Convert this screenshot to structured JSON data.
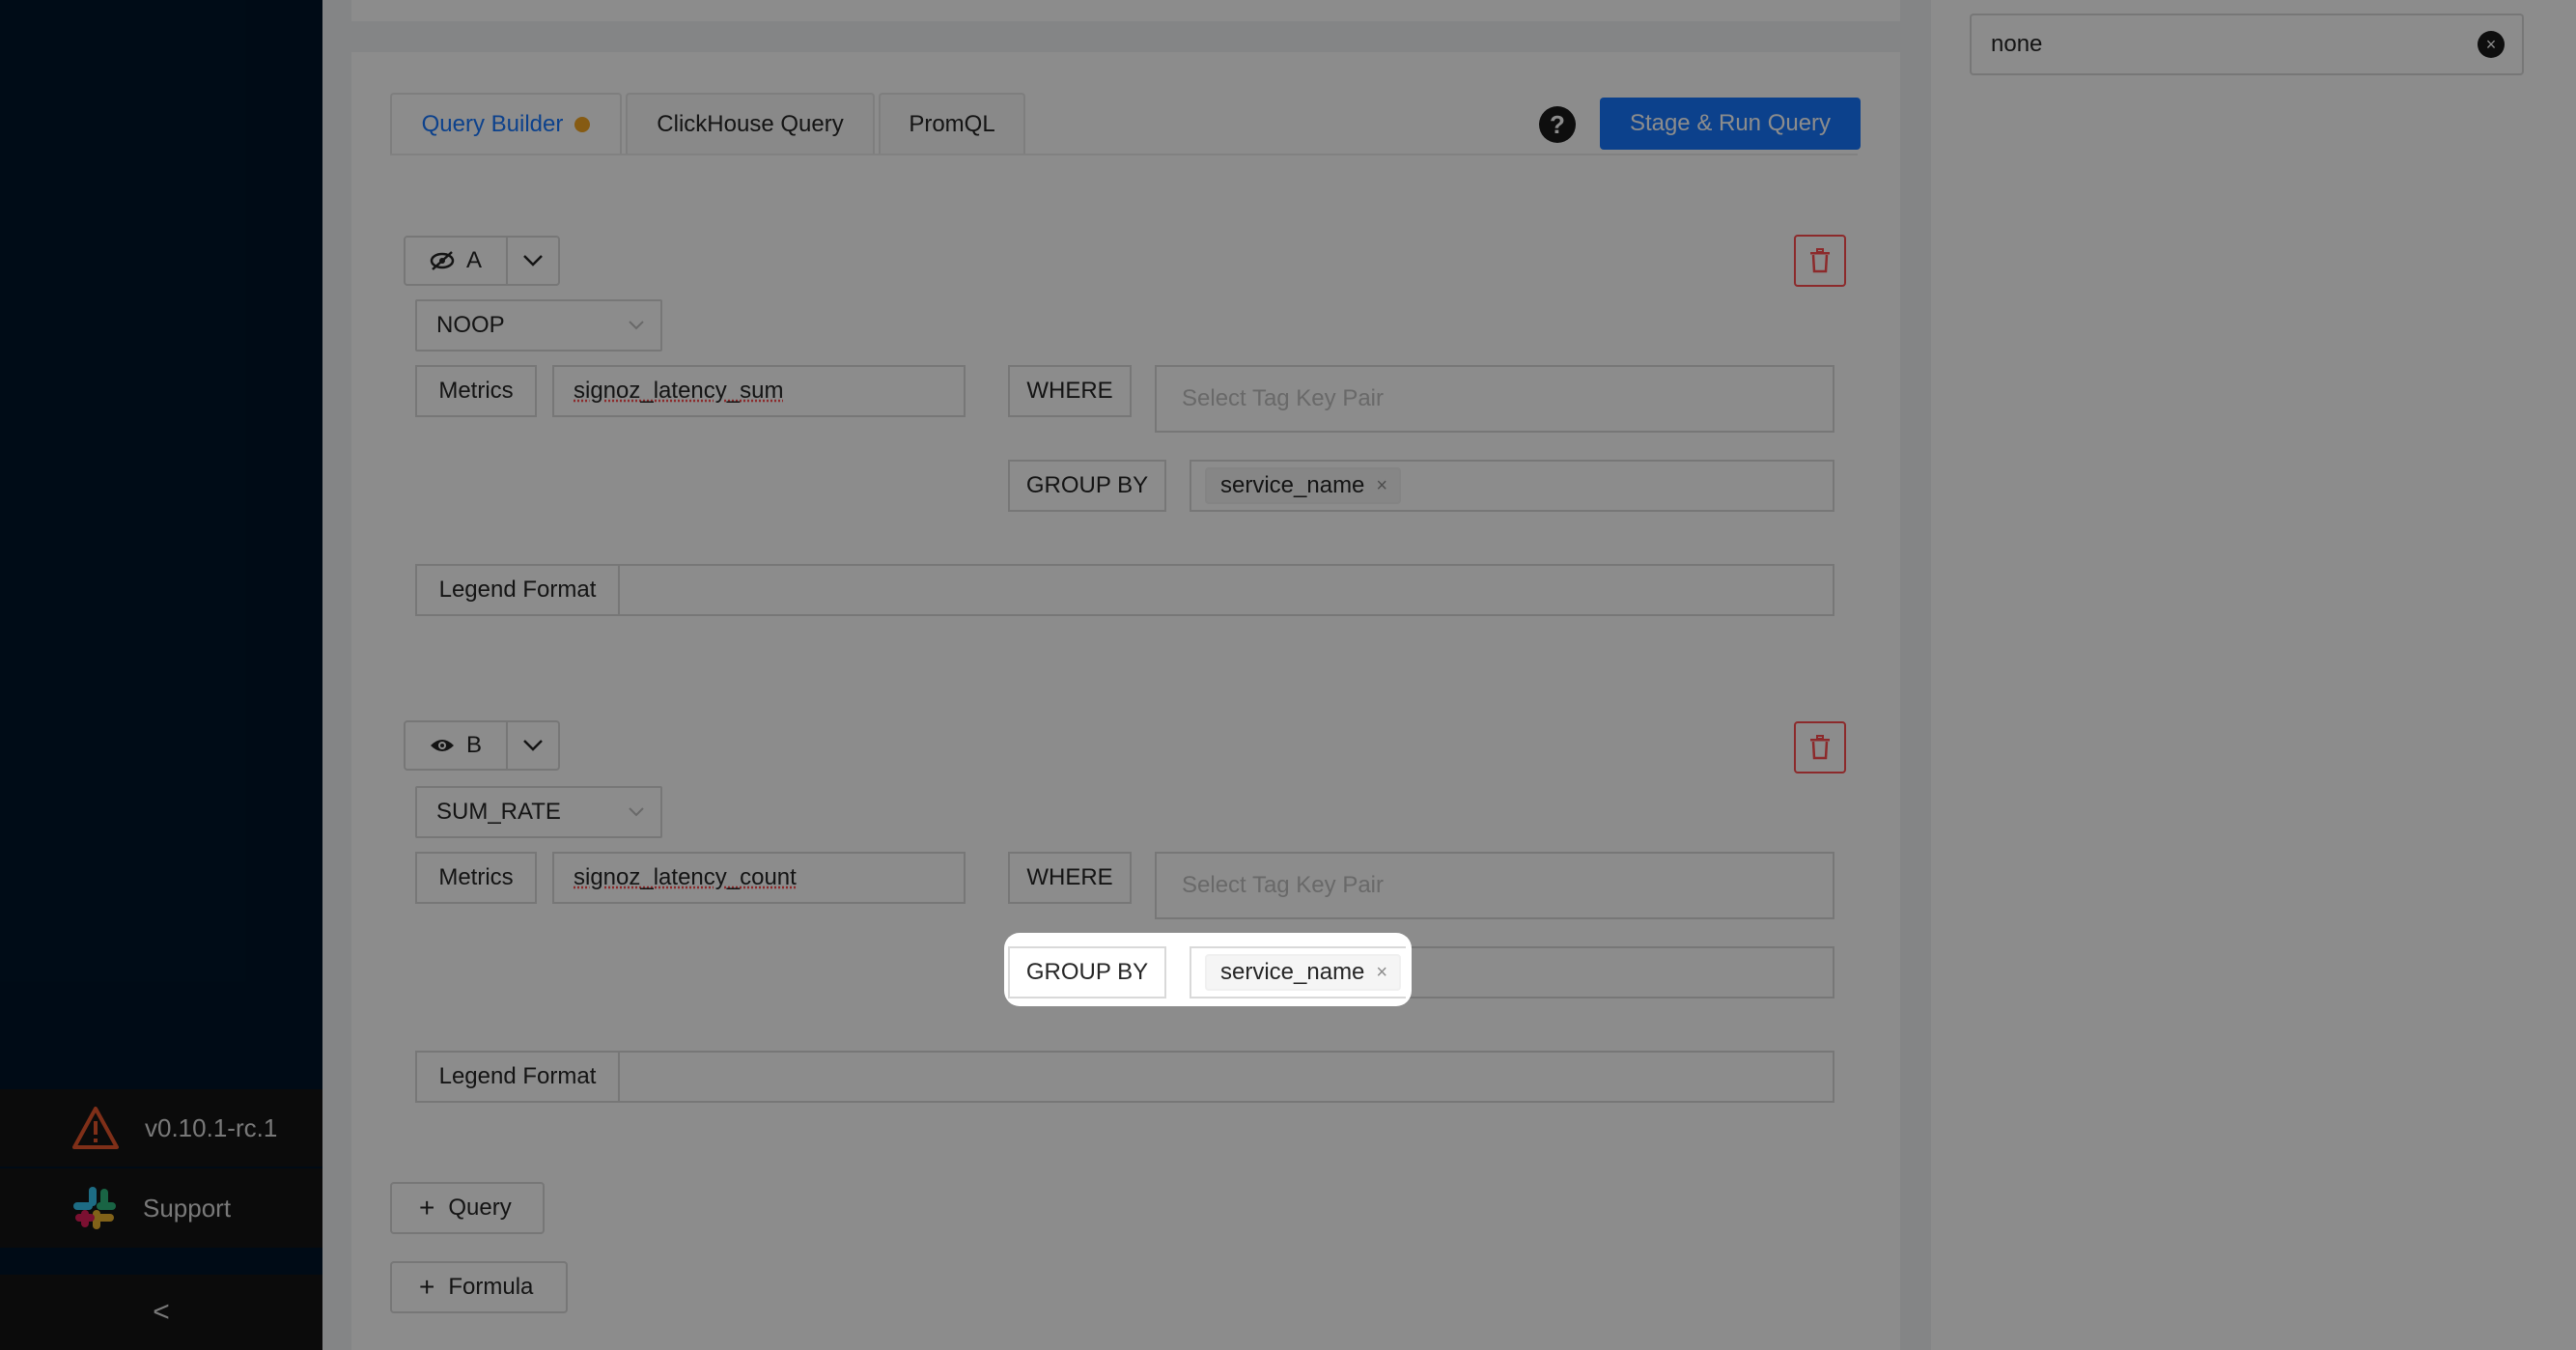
{
  "sidebar": {
    "version": "v0.10.1-rc.1",
    "support": "Support",
    "collapse_glyph": "<",
    "icons": [
      "warning-icon",
      "slack-icon"
    ]
  },
  "tabs": [
    {
      "label": "Query Builder",
      "active": true
    },
    {
      "label": "ClickHouse Query",
      "active": false
    },
    {
      "label": "PromQL",
      "active": false
    }
  ],
  "header": {
    "help_glyph": "?",
    "run_label": "Stage & Run Query"
  },
  "queries": [
    {
      "name": "A",
      "visible": false,
      "aggregation": "NOOP",
      "metrics_label": "Metrics",
      "metric": "signoz_latency_sum",
      "where_label": "WHERE",
      "where_placeholder": "Select Tag Key Pair",
      "group_by_label": "GROUP BY",
      "group_by_tags": [
        "service_name"
      ],
      "legend_label": "Legend Format",
      "legend_value": ""
    },
    {
      "name": "B",
      "visible": true,
      "aggregation": "SUM_RATE",
      "metrics_label": "Metrics",
      "metric": "signoz_latency_count",
      "where_label": "WHERE",
      "where_placeholder": "Select Tag Key Pair",
      "group_by_label": "GROUP BY",
      "group_by_tags": [
        "service_name"
      ],
      "legend_label": "Legend Format",
      "legend_value": ""
    }
  ],
  "actions": {
    "add_query": "Query",
    "add_formula": "Formula",
    "plus": "+"
  },
  "right_panel": {
    "select_value": "none",
    "clear_glyph": "×"
  },
  "tag_remove_glyph": "×",
  "colors": {
    "primary": "#1677ff",
    "danger": "#ff4d4f",
    "sidebar_bg": "#001529",
    "active_dot": "#f5a623"
  }
}
